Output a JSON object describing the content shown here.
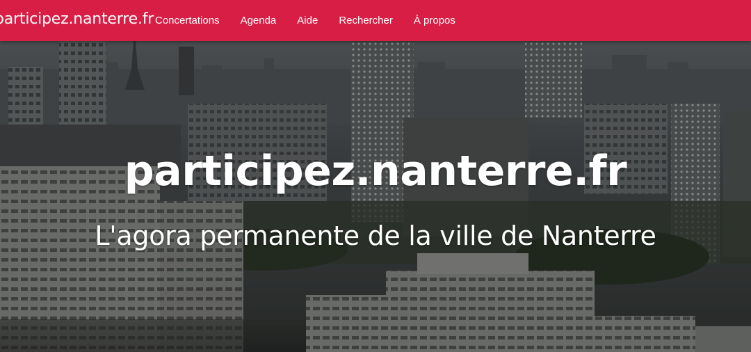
{
  "navbar": {
    "brand": "participez.nanterre.fr",
    "background_color": "#d81e45",
    "links": [
      {
        "label": "Concertations"
      },
      {
        "label": "Agenda"
      },
      {
        "label": "Aide"
      },
      {
        "label": "Rechercher"
      },
      {
        "label": "À propos"
      }
    ]
  },
  "hero": {
    "title": "participez.nanterre.fr",
    "subtitle": "L'agora permanente de la ville de Nanterre",
    "background": "city-skyline-photo"
  }
}
